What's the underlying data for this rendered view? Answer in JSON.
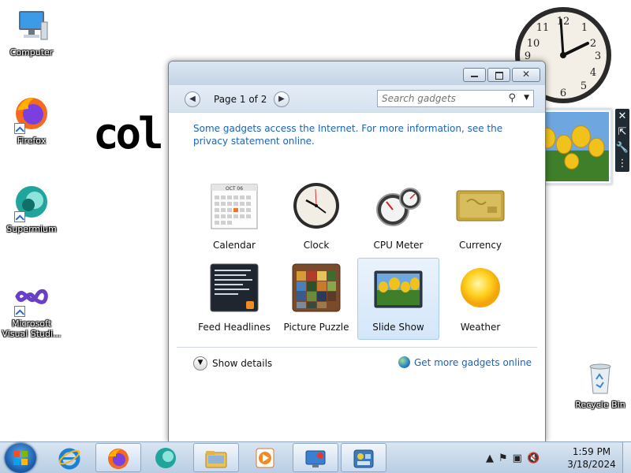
{
  "desktop": {
    "icons": [
      {
        "label": "Computer"
      },
      {
        "label": "Firefox"
      },
      {
        "label": "Supermium"
      },
      {
        "label": "Microsoft Visual Studi..."
      },
      {
        "label": "Recycle Bin"
      }
    ],
    "pixel_text": "col"
  },
  "gadget_window": {
    "nav": {
      "page_label": "Page 1 of 2"
    },
    "search": {
      "placeholder": "Search gadgets"
    },
    "notice": "Some gadgets access the Internet.  For more information, see the privacy statement online.",
    "calendar_month": "OCT 06",
    "gadgets": [
      {
        "name": "Calendar"
      },
      {
        "name": "Clock"
      },
      {
        "name": "CPU Meter"
      },
      {
        "name": "Currency"
      },
      {
        "name": "Feed Headlines"
      },
      {
        "name": "Picture Puzzle"
      },
      {
        "name": "Slide Show",
        "selected": true
      },
      {
        "name": "Weather"
      }
    ],
    "show_details": "Show details",
    "get_more": "Get more gadgets online"
  },
  "taskbar": {
    "time": "1:59 PM",
    "date": "3/18/2024"
  },
  "colors": {
    "link": "#1a64b8",
    "selection": "#d3e6f9",
    "taskbar": "#b9cde3"
  }
}
